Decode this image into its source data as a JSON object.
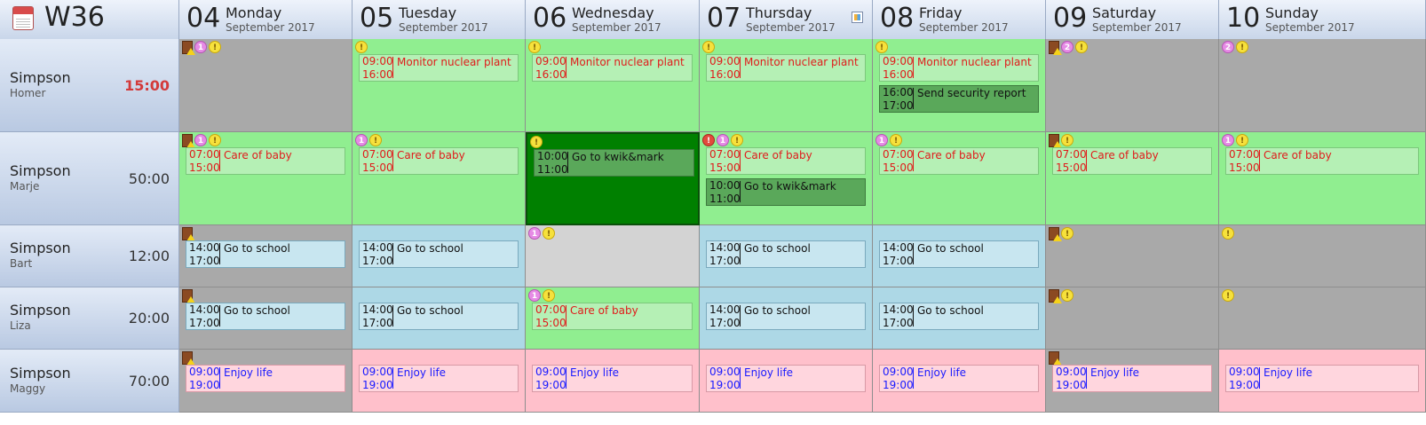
{
  "week_label": "W36",
  "days": [
    {
      "num": "04",
      "name": "Monday",
      "month": "September 2017"
    },
    {
      "num": "05",
      "name": "Tuesday",
      "month": "September 2017"
    },
    {
      "num": "06",
      "name": "Wednesday",
      "month": "September 2017"
    },
    {
      "num": "07",
      "name": "Thursday",
      "month": "September 2017",
      "today_icon": true
    },
    {
      "num": "08",
      "name": "Friday",
      "month": "September 2017"
    },
    {
      "num": "09",
      "name": "Saturday",
      "month": "September 2017"
    },
    {
      "num": "10",
      "name": "Sunday",
      "month": "September 2017"
    }
  ],
  "colors": {
    "off": "#a9a9a9",
    "work": "#90ee90",
    "work_dark": "#008000",
    "school": "#add8e6",
    "life": "#ffc0cb",
    "empty": "#d3d3d3",
    "appt_work_bg": "#b5f0b5",
    "appt_work_fg": "#e01b1b",
    "appt_dark_bg": "#5aa85a",
    "appt_dark_fg": "#111111",
    "appt_school_bg": "#c8e6f0",
    "appt_school_fg": "#111111",
    "appt_life_bg": "#ffd6de",
    "appt_life_fg": "#1a1aff"
  },
  "people": [
    {
      "last": "Simpson",
      "first": "Homer",
      "hours": "15:00",
      "alert": true,
      "cells": [
        {
          "bg": "off",
          "icons": [
            "door",
            "pink:1",
            "yellow:!"
          ],
          "appts": []
        },
        {
          "bg": "work",
          "icons": [
            "yellow:!"
          ],
          "appts": [
            {
              "start": "09:00",
              "end": "16:00",
              "title": "Monitor nuclear plant",
              "style": "work"
            }
          ]
        },
        {
          "bg": "work",
          "icons": [
            "yellow:!"
          ],
          "appts": [
            {
              "start": "09:00",
              "end": "16:00",
              "title": "Monitor nuclear plant",
              "style": "work"
            }
          ]
        },
        {
          "bg": "work",
          "icons": [
            "yellow:!"
          ],
          "appts": [
            {
              "start": "09:00",
              "end": "16:00",
              "title": "Monitor nuclear plant",
              "style": "work"
            }
          ]
        },
        {
          "bg": "work",
          "icons": [
            "yellow:!"
          ],
          "appts": [
            {
              "start": "09:00",
              "end": "16:00",
              "title": "Monitor nuclear plant",
              "style": "work"
            },
            {
              "start": "16:00",
              "end": "17:00",
              "title": "Send security report",
              "style": "dark"
            }
          ]
        },
        {
          "bg": "off",
          "icons": [
            "door",
            "pink:2",
            "yellow:!"
          ],
          "appts": []
        },
        {
          "bg": "off",
          "icons": [
            "pink:2",
            "yellow:!"
          ],
          "appts": []
        }
      ]
    },
    {
      "last": "Simpson",
      "first": "Marje",
      "hours": "50:00",
      "alert": false,
      "cells": [
        {
          "bg": "work",
          "icons": [
            "door",
            "pink:1",
            "yellow:!"
          ],
          "appts": [
            {
              "start": "07:00",
              "end": "15:00",
              "title": "Care of baby",
              "style": "work"
            }
          ]
        },
        {
          "bg": "work",
          "icons": [
            "pink:1",
            "yellow:!"
          ],
          "appts": [
            {
              "start": "07:00",
              "end": "15:00",
              "title": "Care of baby",
              "style": "work"
            }
          ]
        },
        {
          "bg": "work_dark",
          "selected": true,
          "icons": [
            "yellow:!"
          ],
          "appts": [
            {
              "start": "10:00",
              "end": "11:00",
              "title": "Go to kwik&mark",
              "style": "dark"
            }
          ]
        },
        {
          "bg": "work",
          "icons": [
            "red:!",
            "pink:1",
            "yellow:!"
          ],
          "appts": [
            {
              "start": "07:00",
              "end": "15:00",
              "title": "Care of baby",
              "style": "work"
            },
            {
              "start": "10:00",
              "end": "11:00",
              "title": "Go to kwik&mark",
              "style": "dark"
            }
          ]
        },
        {
          "bg": "work",
          "icons": [
            "pink:1",
            "yellow:!"
          ],
          "appts": [
            {
              "start": "07:00",
              "end": "15:00",
              "title": "Care of baby",
              "style": "work"
            }
          ]
        },
        {
          "bg": "work",
          "icons": [
            "door",
            "yellow:!"
          ],
          "appts": [
            {
              "start": "07:00",
              "end": "15:00",
              "title": "Care of baby",
              "style": "work"
            }
          ]
        },
        {
          "bg": "work",
          "icons": [
            "pink:1",
            "yellow:!"
          ],
          "appts": [
            {
              "start": "07:00",
              "end": "15:00",
              "title": "Care of baby",
              "style": "work"
            }
          ]
        }
      ]
    },
    {
      "last": "Simpson",
      "first": "Bart",
      "hours": "12:00",
      "alert": false,
      "cells": [
        {
          "bg": "off",
          "icons": [
            "door"
          ],
          "appts": [
            {
              "start": "14:00",
              "end": "17:00",
              "title": "Go to school",
              "style": "school"
            }
          ]
        },
        {
          "bg": "school",
          "icons": [],
          "appts": [
            {
              "start": "14:00",
              "end": "17:00",
              "title": "Go to school",
              "style": "school"
            }
          ]
        },
        {
          "bg": "empty",
          "icons": [
            "pink:1",
            "yellow:!"
          ],
          "appts": []
        },
        {
          "bg": "school",
          "icons": [],
          "appts": [
            {
              "start": "14:00",
              "end": "17:00",
              "title": "Go to school",
              "style": "school"
            }
          ]
        },
        {
          "bg": "school",
          "icons": [],
          "appts": [
            {
              "start": "14:00",
              "end": "17:00",
              "title": "Go to school",
              "style": "school"
            }
          ]
        },
        {
          "bg": "off",
          "icons": [
            "door",
            "yellow:!"
          ],
          "appts": []
        },
        {
          "bg": "off",
          "icons": [
            "yellow:!"
          ],
          "appts": []
        }
      ]
    },
    {
      "last": "Simpson",
      "first": "Liza",
      "hours": "20:00",
      "alert": false,
      "cells": [
        {
          "bg": "off",
          "icons": [
            "door"
          ],
          "appts": [
            {
              "start": "14:00",
              "end": "17:00",
              "title": "Go to school",
              "style": "school"
            }
          ]
        },
        {
          "bg": "school",
          "icons": [],
          "appts": [
            {
              "start": "14:00",
              "end": "17:00",
              "title": "Go to school",
              "style": "school"
            }
          ]
        },
        {
          "bg": "work",
          "icons": [
            "pink:1",
            "yellow:!"
          ],
          "appts": [
            {
              "start": "07:00",
              "end": "15:00",
              "title": "Care of baby",
              "style": "work"
            }
          ]
        },
        {
          "bg": "school",
          "icons": [],
          "appts": [
            {
              "start": "14:00",
              "end": "17:00",
              "title": "Go to school",
              "style": "school"
            }
          ]
        },
        {
          "bg": "school",
          "icons": [],
          "appts": [
            {
              "start": "14:00",
              "end": "17:00",
              "title": "Go to school",
              "style": "school"
            }
          ]
        },
        {
          "bg": "off",
          "icons": [
            "door",
            "yellow:!"
          ],
          "appts": []
        },
        {
          "bg": "off",
          "icons": [
            "yellow:!"
          ],
          "appts": []
        }
      ]
    },
    {
      "last": "Simpson",
      "first": "Maggy",
      "hours": "70:00",
      "alert": false,
      "cells": [
        {
          "bg": "off",
          "icons": [
            "door"
          ],
          "appts": [
            {
              "start": "09:00",
              "end": "19:00",
              "title": "Enjoy life",
              "style": "life"
            }
          ]
        },
        {
          "bg": "life",
          "icons": [],
          "appts": [
            {
              "start": "09:00",
              "end": "19:00",
              "title": "Enjoy life",
              "style": "life"
            }
          ]
        },
        {
          "bg": "life",
          "icons": [],
          "appts": [
            {
              "start": "09:00",
              "end": "19:00",
              "title": "Enjoy life",
              "style": "life"
            }
          ]
        },
        {
          "bg": "life",
          "icons": [],
          "appts": [
            {
              "start": "09:00",
              "end": "19:00",
              "title": "Enjoy life",
              "style": "life"
            }
          ]
        },
        {
          "bg": "life",
          "icons": [],
          "appts": [
            {
              "start": "09:00",
              "end": "19:00",
              "title": "Enjoy life",
              "style": "life"
            }
          ]
        },
        {
          "bg": "off",
          "icons": [
            "door"
          ],
          "appts": [
            {
              "start": "09:00",
              "end": "19:00",
              "title": "Enjoy life",
              "style": "life"
            }
          ]
        },
        {
          "bg": "life",
          "icons": [],
          "appts": [
            {
              "start": "09:00",
              "end": "19:00",
              "title": "Enjoy life",
              "style": "life"
            }
          ]
        }
      ]
    }
  ]
}
